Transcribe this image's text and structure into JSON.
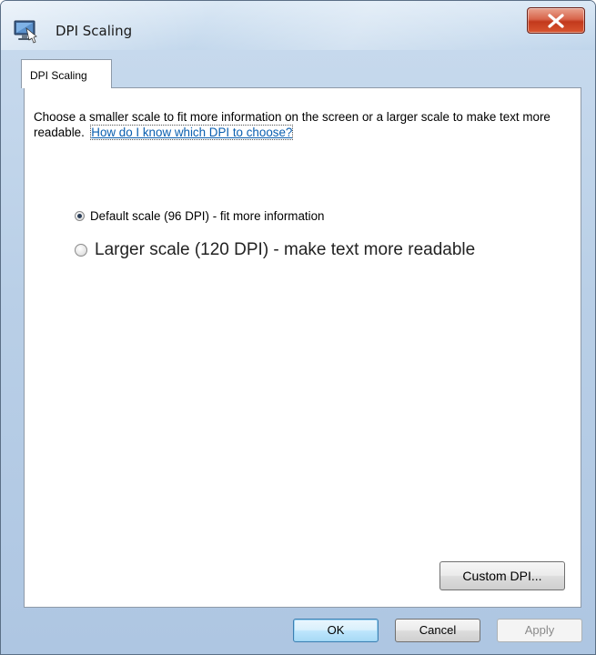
{
  "window": {
    "title": "DPI Scaling",
    "app_icon": "display-settings-icon",
    "close_icon": "close-icon"
  },
  "tabs": [
    {
      "label": "DPI Scaling",
      "selected": true
    }
  ],
  "panel": {
    "description": "Choose a smaller scale to fit more information on the screen or a larger scale to make text more readable.",
    "help_link": "How do I know which DPI to choose?",
    "options": [
      {
        "label": "Default scale (96 DPI) - fit more information",
        "checked": true
      },
      {
        "label": "Larger scale (120 DPI) - make text more readable",
        "checked": false
      }
    ],
    "custom_dpi_label": "Custom DPI..."
  },
  "footer": {
    "ok_label": "OK",
    "cancel_label": "Cancel",
    "apply_label": "Apply",
    "apply_enabled": false
  },
  "colors": {
    "link": "#0a5fb0",
    "close_button": "#c2391c",
    "window_frame": "#b9cfe7"
  }
}
